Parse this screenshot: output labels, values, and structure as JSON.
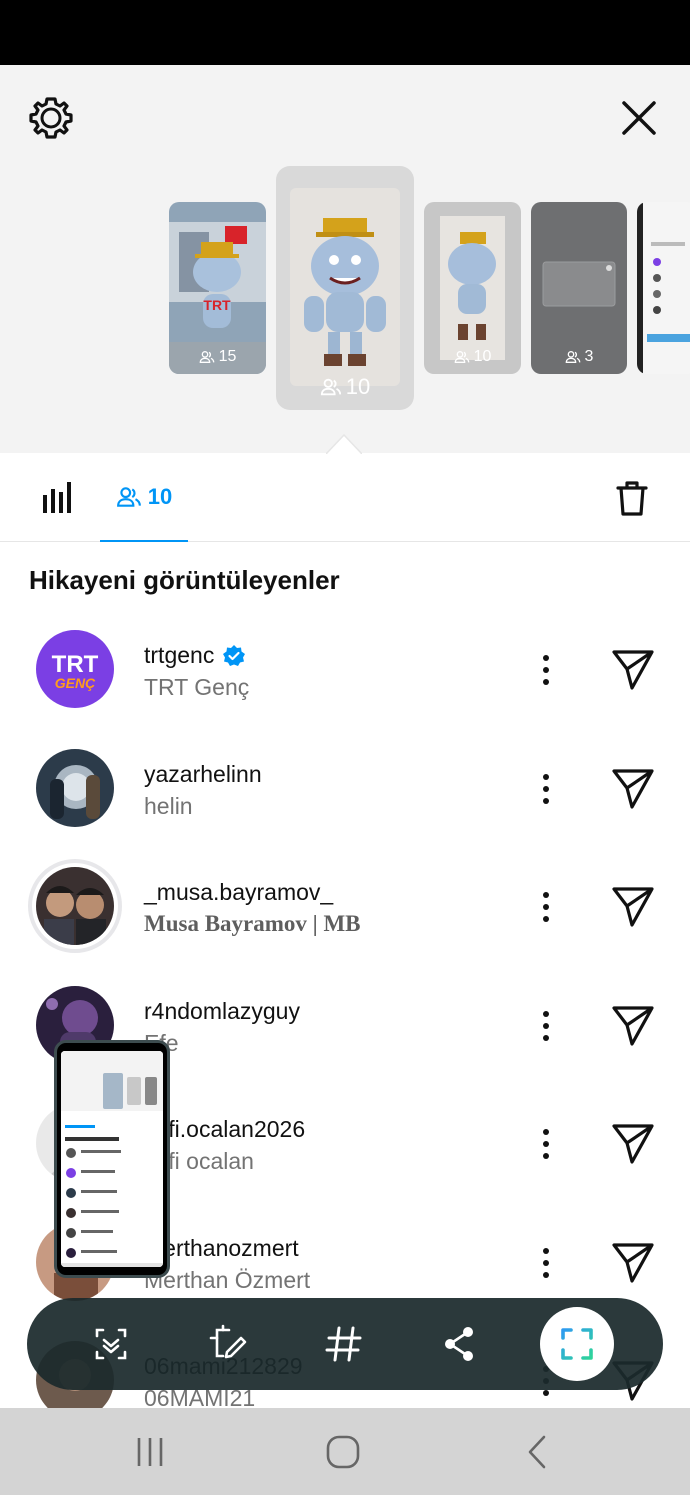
{
  "header": {
    "settings_icon": "gear-icon",
    "close_icon": "close-icon"
  },
  "stories": [
    {
      "count": "15"
    },
    {
      "count": "10"
    },
    {
      "count": "10"
    },
    {
      "count": "3"
    }
  ],
  "tabs": {
    "stats_icon": "bar-chart-icon",
    "viewers_count": "10",
    "delete_icon": "trash-icon"
  },
  "section_title": "Hikayeni görüntüleyenler",
  "viewers": [
    {
      "username": "trtgenc",
      "verified": true,
      "fullname": "TRT Genç",
      "avatar_text_top": "TRT",
      "avatar_text_bottom": "GENÇ"
    },
    {
      "username": "yazarhelinn",
      "verified": false,
      "fullname": "helin"
    },
    {
      "username": "_musa.bayramov_",
      "verified": false,
      "fullname": "Musa Bayramov | MB"
    },
    {
      "username": "r4ndomlazyguy",
      "verified": false,
      "fullname": "Efe"
    },
    {
      "username": "lütfi.ocalan2026",
      "verified": false,
      "fullname": "lütfi ocalan"
    },
    {
      "username": "merthanozmert",
      "verified": false,
      "fullname": "Merthan Özmert"
    },
    {
      "username": "06mami212829",
      "verified": false,
      "fullname": "06MAMI21"
    }
  ],
  "toolbar": {
    "items": [
      "scroll-capture-icon",
      "draw-edit-icon",
      "hashtag-icon",
      "share-icon",
      "capture-area-icon"
    ]
  },
  "navbar": {
    "items": [
      "recent-apps-icon",
      "home-icon",
      "back-icon"
    ]
  },
  "colors": {
    "accent": "#0095f6",
    "trt_purple": "#7b3fe4",
    "trt_orange": "#ff9d1b",
    "toolbar_bg": "#1b2a2c"
  }
}
